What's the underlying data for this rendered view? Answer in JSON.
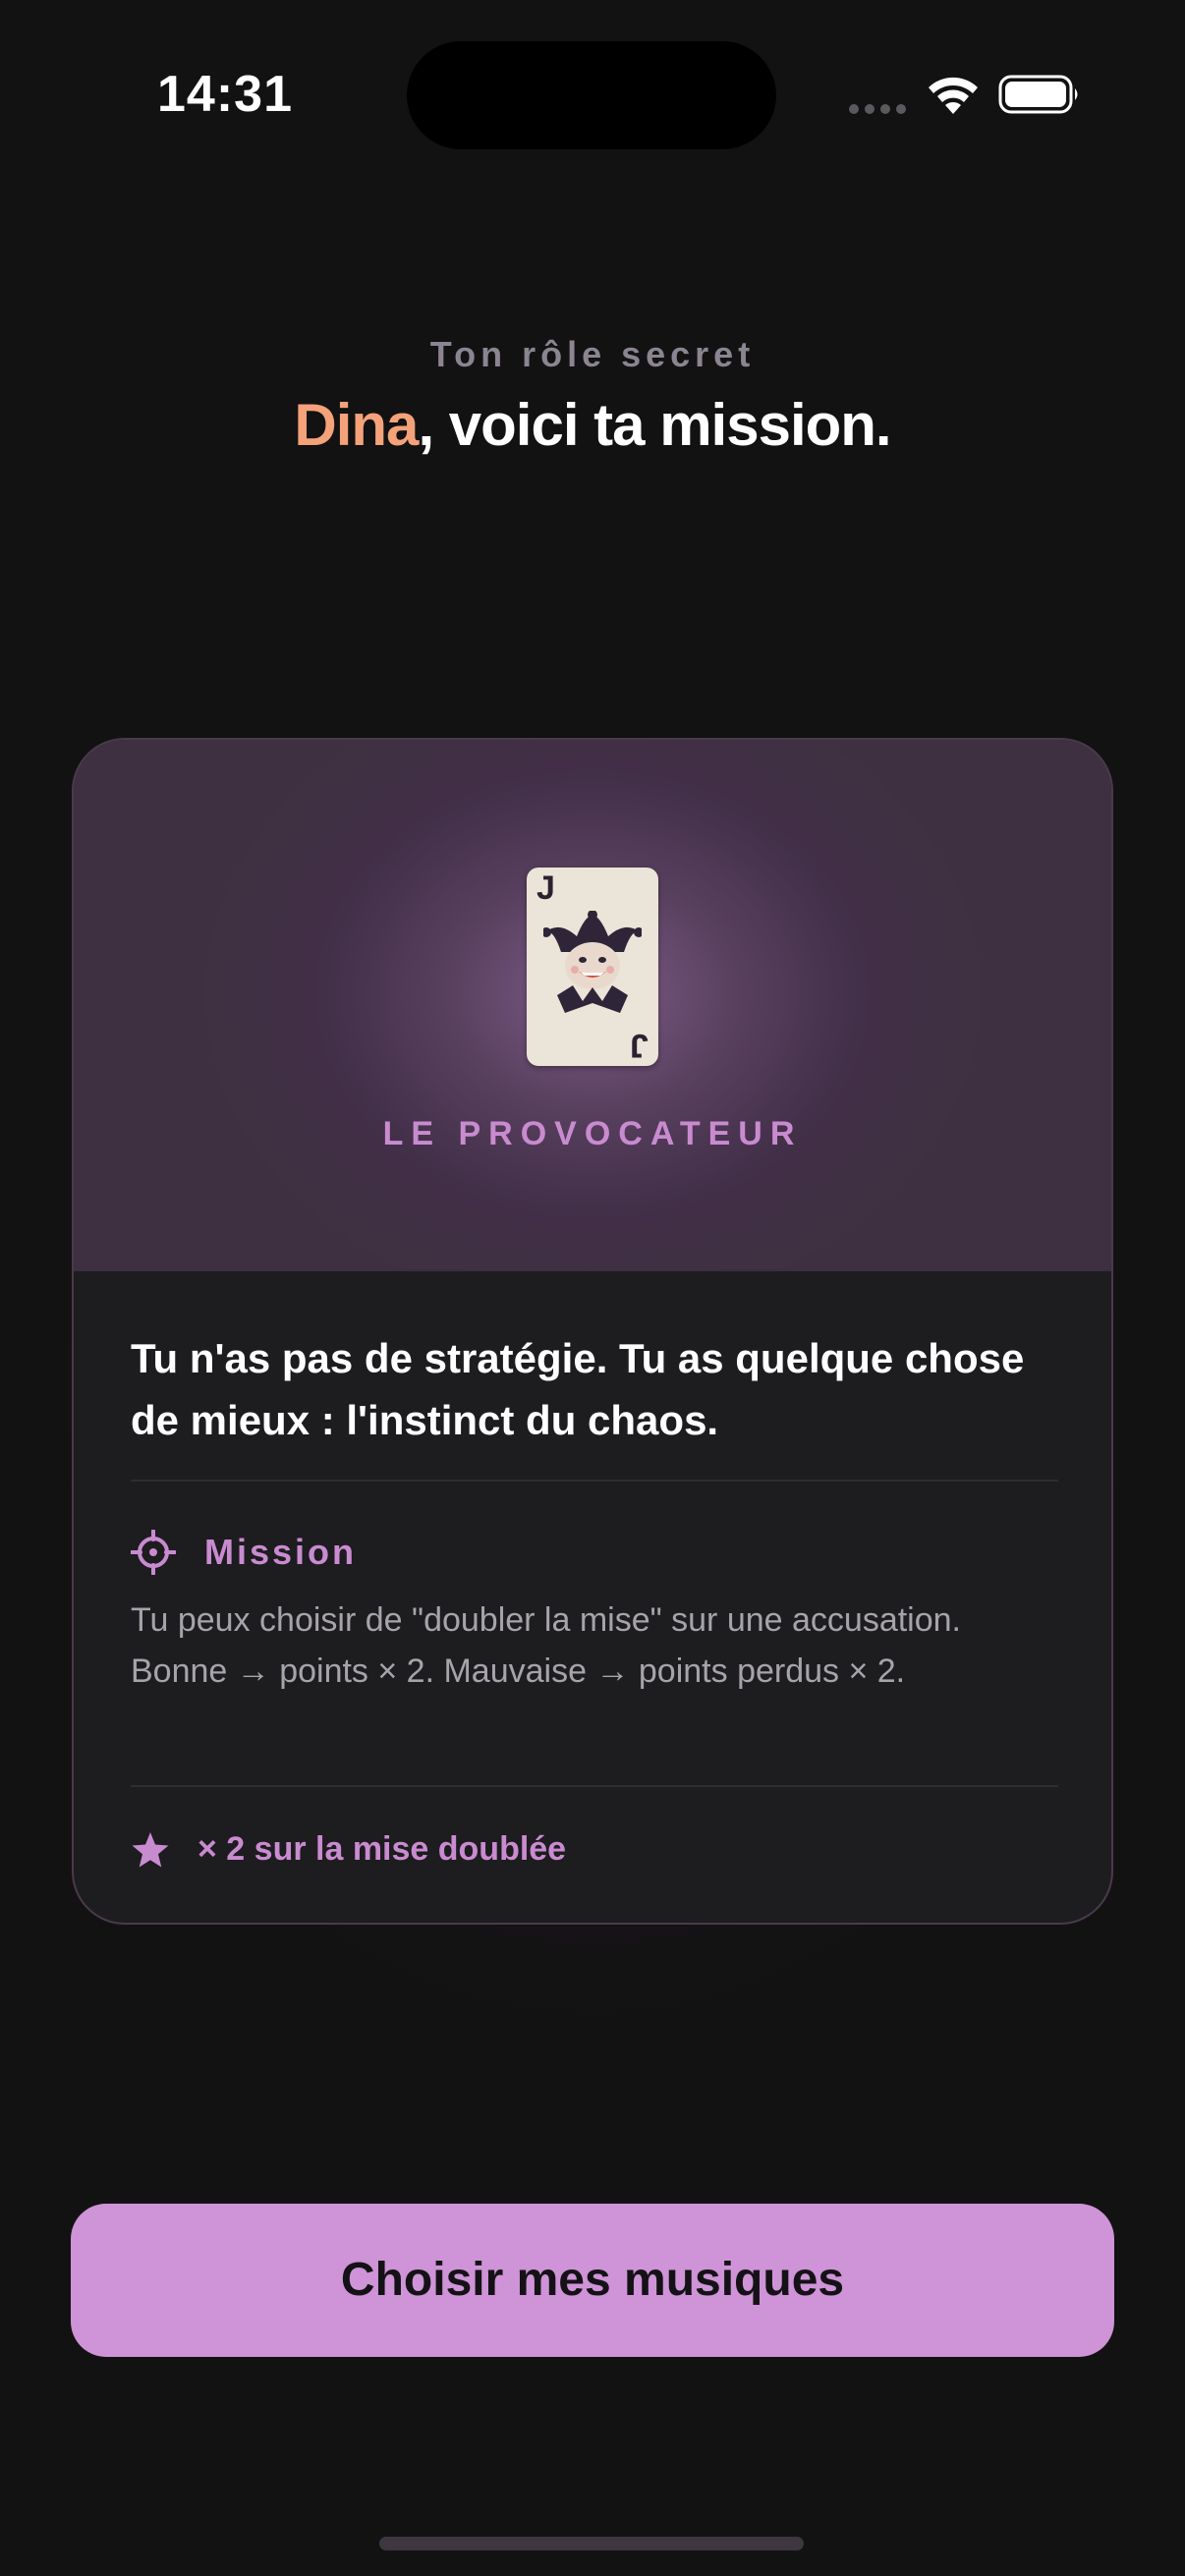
{
  "status_bar": {
    "time": "14:31",
    "wifi_icon": "wifi-icon",
    "battery_icon": "battery-full-icon"
  },
  "header": {
    "eyebrow": "Ton rôle secret",
    "player_name": "Dina",
    "title_rest": ", voici ta mission."
  },
  "role_card": {
    "card_icon": "joker-card-icon",
    "card_rank": "J",
    "role_name": "LE PROVOCATEUR",
    "tagline": "Tu n'as pas de stratégie. Tu as quelque chose de mieux : l'instinct du chaos.",
    "mission": {
      "icon": "crosshair-icon",
      "title": "Mission",
      "text": "Tu peux choisir de \"doubler la mise\" sur une accusation. Bonne → points × 2. Mauvaise → points perdus × 2."
    },
    "bonus": {
      "icon": "star-icon",
      "text": "× 2 sur la mise doublée"
    }
  },
  "cta": {
    "label": "Choisir mes musiques"
  },
  "colors": {
    "background": "#121212",
    "accent": "#cf93d7",
    "name_highlight": "#f4a27a",
    "card_background": "#1d1c1f"
  }
}
